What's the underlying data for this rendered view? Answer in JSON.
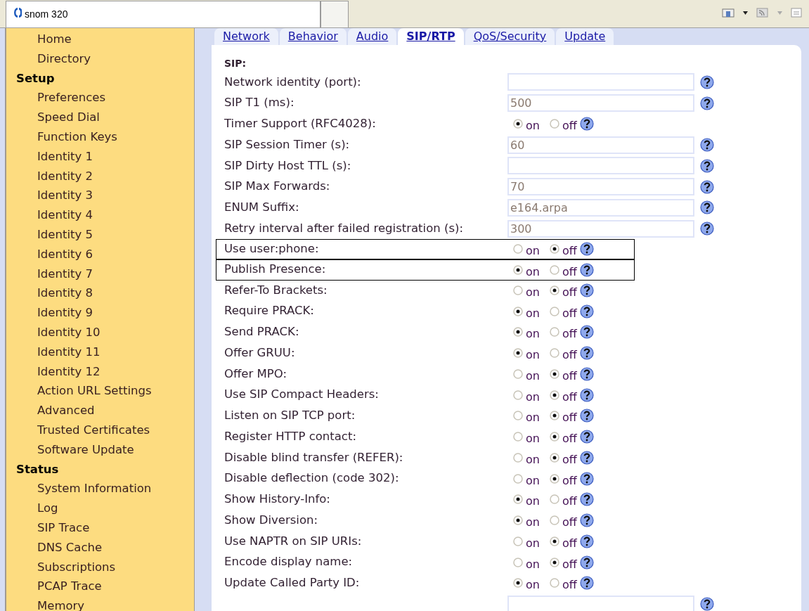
{
  "browser_tab": {
    "title": "snom 320"
  },
  "sidebar": {
    "sections": [
      {
        "items": [
          "Home",
          "Directory"
        ]
      },
      {
        "heading": "Setup",
        "items": [
          "Preferences",
          "Speed Dial",
          "Function Keys",
          "Identity 1",
          "Identity 2",
          "Identity 3",
          "Identity 4",
          "Identity 5",
          "Identity 6",
          "Identity 7",
          "Identity 8",
          "Identity 9",
          "Identity 10",
          "Identity 11",
          "Identity 12",
          "Action URL Settings",
          "Advanced",
          "Trusted Certificates",
          "Software Update"
        ]
      },
      {
        "heading": "Status",
        "items": [
          "System Information",
          "Log",
          "SIP Trace",
          "DNS Cache",
          "Subscriptions",
          "PCAP Trace",
          "Memory"
        ]
      }
    ]
  },
  "tabs": [
    {
      "label": "Network",
      "selected": false
    },
    {
      "label": "Behavior",
      "selected": false
    },
    {
      "label": "Audio",
      "selected": false
    },
    {
      "label": "SIP/RTP",
      "selected": true
    },
    {
      "label": "QoS/Security",
      "selected": false
    },
    {
      "label": "Update",
      "selected": false
    }
  ],
  "section_title": "SIP:",
  "settings": [
    {
      "kind": "field",
      "label": "Network identity (port):",
      "outlined": false
    },
    {
      "kind": "field",
      "label": "SIP T1 (ms):",
      "value": "500",
      "outlined": false
    },
    {
      "kind": "toggle",
      "label": "Timer Support (RFC4028):",
      "on": true,
      "on_label": "on",
      "off_label": "off",
      "outlined": false
    },
    {
      "kind": "field",
      "label": "SIP Session Timer (s):",
      "value": "60",
      "outlined": false
    },
    {
      "kind": "field",
      "label": "SIP Dirty Host TTL (s):",
      "outlined": false
    },
    {
      "kind": "field",
      "label": "SIP Max Forwards:",
      "value": "70",
      "outlined": false
    },
    {
      "kind": "field",
      "label": "ENUM Suffix:",
      "value": "e164.arpa",
      "outlined": false
    },
    {
      "kind": "field",
      "label": "Retry interval after failed registration (s):",
      "value": "300",
      "outlined": false
    },
    {
      "kind": "toggle",
      "label": "Use user:phone:",
      "on": false,
      "on_label": "on",
      "off_label": "off",
      "outlined": true
    },
    {
      "kind": "toggle",
      "label": "Publish Presence:",
      "on": true,
      "on_label": "on",
      "off_label": "off",
      "outlined": true
    },
    {
      "kind": "toggle",
      "label": "Refer-To Brackets:",
      "on": false,
      "on_label": "on",
      "off_label": "off",
      "outlined": false
    },
    {
      "kind": "toggle",
      "label": "Require PRACK:",
      "on": true,
      "on_label": "on",
      "off_label": "off",
      "outlined": false
    },
    {
      "kind": "toggle",
      "label": "Send PRACK:",
      "on": true,
      "on_label": "on",
      "off_label": "off",
      "outlined": false
    },
    {
      "kind": "toggle",
      "label": "Offer GRUU:",
      "on": true,
      "on_label": "on",
      "off_label": "off",
      "outlined": false
    },
    {
      "kind": "toggle",
      "label": "Offer MPO:",
      "on": false,
      "on_label": "on",
      "off_label": "off",
      "outlined": false
    },
    {
      "kind": "toggle",
      "label": "Use SIP Compact Headers:",
      "on": false,
      "on_label": "on",
      "off_label": "off",
      "outlined": false
    },
    {
      "kind": "toggle",
      "label": "Listen on SIP TCP port:",
      "on": false,
      "on_label": "on",
      "off_label": "off",
      "outlined": false
    },
    {
      "kind": "toggle",
      "label": "Register HTTP contact:",
      "on": false,
      "on_label": "on",
      "off_label": "off",
      "outlined": false
    },
    {
      "kind": "toggle",
      "label": "Disable blind transfer (REFER):",
      "on": false,
      "on_label": "on",
      "off_label": "off",
      "outlined": false
    },
    {
      "kind": "toggle",
      "label": "Disable deflection (code 302):",
      "on": false,
      "on_label": "on",
      "off_label": "off",
      "outlined": false
    },
    {
      "kind": "toggle",
      "label": "Show History-Info:",
      "on": true,
      "on_label": "on",
      "off_label": "off",
      "outlined": false
    },
    {
      "kind": "toggle",
      "label": "Show Diversion:",
      "on": true,
      "on_label": "on",
      "off_label": "off",
      "outlined": false
    },
    {
      "kind": "toggle",
      "label": "Use NAPTR on SIP URIs:",
      "on": false,
      "on_label": "on",
      "off_label": "off",
      "outlined": false
    },
    {
      "kind": "toggle",
      "label": "Encode display name:",
      "on": false,
      "on_label": "on",
      "off_label": "off",
      "outlined": false
    },
    {
      "kind": "toggle",
      "label": "Update Called Party ID:",
      "on": true,
      "on_label": "on",
      "off_label": "off",
      "outlined": false
    },
    {
      "kind": "field",
      "outlined": false
    }
  ]
}
